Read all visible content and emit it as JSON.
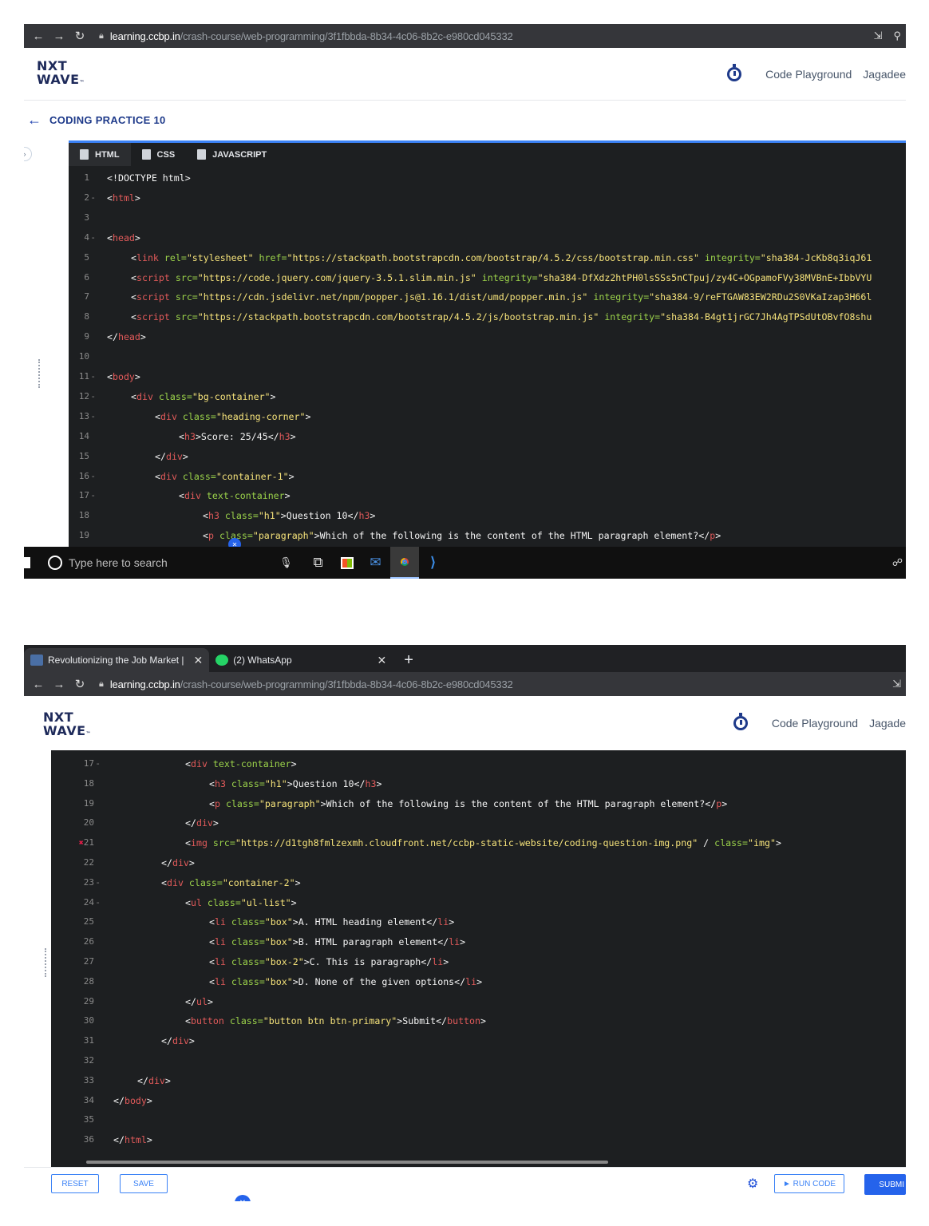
{
  "browser": {
    "url_host": "learning.ccbp.in",
    "url_path": "/crash-course/web-programming/3f1fbbda-8b34-4c06-8b2c-e980cd045332",
    "tabs": [
      {
        "title": "Revolutionizing the Job Market |",
        "favicon_color": "#4a6fa5"
      },
      {
        "title": "(2) WhatsApp",
        "favicon_color": "#25d366"
      }
    ],
    "new_tab": "+"
  },
  "header": {
    "logo_line1": "NXT",
    "logo_line2": "WAVE",
    "logo_tm": "™",
    "code_playground": "Code Playground",
    "user_truncated_1": "Jagadee",
    "user_truncated_2": "Jagade"
  },
  "practice": {
    "title": "CODING PRACTICE 10"
  },
  "editor_tabs": [
    {
      "label": "HTML"
    },
    {
      "label": "CSS"
    },
    {
      "label": "JAVASCRIPT"
    }
  ],
  "taskbar": {
    "search_placeholder": "Type here to search"
  },
  "footer": {
    "reset": "RESET",
    "save": "SAVE",
    "run_code": "► RUN CODE",
    "submit": "SUBMI"
  },
  "code_top": [
    {
      "n": "1",
      "fold": false,
      "indent": 0,
      "parts": [
        [
          "tx",
          "<!DOCTYPE html>"
        ]
      ]
    },
    {
      "n": "2",
      "fold": true,
      "indent": 0,
      "parts": [
        [
          "tx",
          "<"
        ],
        [
          "tg",
          "html"
        ],
        [
          "tx",
          ">"
        ]
      ]
    },
    {
      "n": "3",
      "fold": false,
      "indent": 0,
      "parts": []
    },
    {
      "n": "4",
      "fold": true,
      "indent": 0,
      "parts": [
        [
          "tx",
          "<"
        ],
        [
          "tg",
          "head"
        ],
        [
          "tx",
          ">"
        ]
      ]
    },
    {
      "n": "5",
      "fold": false,
      "indent": 1,
      "parts": [
        [
          "tx",
          "<"
        ],
        [
          "tg",
          "link"
        ],
        [
          "at",
          " rel="
        ],
        [
          "st",
          "\"stylesheet\""
        ],
        [
          "at",
          " href="
        ],
        [
          "st",
          "\"https://stackpath.bootstrapcdn.com/bootstrap/4.5.2/css/bootstrap.min.css\""
        ],
        [
          "at",
          " integrity="
        ],
        [
          "st",
          "\"sha384-JcKb8q3iqJ61"
        ]
      ]
    },
    {
      "n": "6",
      "fold": false,
      "indent": 1,
      "parts": [
        [
          "tx",
          "<"
        ],
        [
          "tg",
          "script"
        ],
        [
          "at",
          " src="
        ],
        [
          "st",
          "\"https://code.jquery.com/jquery-3.5.1.slim.min.js\""
        ],
        [
          "at",
          " integrity="
        ],
        [
          "st",
          "\"sha384-DfXdz2htPH0lsSSs5nCTpuj/zy4C+OGpamoFVy38MVBnE+IbbVYU"
        ]
      ]
    },
    {
      "n": "7",
      "fold": false,
      "indent": 1,
      "parts": [
        [
          "tx",
          "<"
        ],
        [
          "tg",
          "script"
        ],
        [
          "at",
          " src="
        ],
        [
          "st",
          "\"https://cdn.jsdelivr.net/npm/popper.js@1.16.1/dist/umd/popper.min.js\""
        ],
        [
          "at",
          " integrity="
        ],
        [
          "st",
          "\"sha384-9/reFTGAW83EW2RDu2S0VKaIzap3H66l"
        ]
      ]
    },
    {
      "n": "8",
      "fold": false,
      "indent": 1,
      "parts": [
        [
          "tx",
          "<"
        ],
        [
          "tg",
          "script"
        ],
        [
          "at",
          " src="
        ],
        [
          "st",
          "\"https://stackpath.bootstrapcdn.com/bootstrap/4.5.2/js/bootstrap.min.js\""
        ],
        [
          "at",
          " integrity="
        ],
        [
          "st",
          "\"sha384-B4gt1jrGC7Jh4AgTPSdUtOBvfO8shu"
        ]
      ]
    },
    {
      "n": "9",
      "fold": false,
      "indent": 0,
      "parts": [
        [
          "tx",
          "</"
        ],
        [
          "tg",
          "head"
        ],
        [
          "tx",
          ">"
        ]
      ]
    },
    {
      "n": "10",
      "fold": false,
      "indent": 0,
      "parts": []
    },
    {
      "n": "11",
      "fold": true,
      "indent": 0,
      "parts": [
        [
          "tx",
          "<"
        ],
        [
          "tg",
          "body"
        ],
        [
          "tx",
          ">"
        ]
      ]
    },
    {
      "n": "12",
      "fold": true,
      "indent": 1,
      "parts": [
        [
          "tx",
          "<"
        ],
        [
          "tg",
          "div"
        ],
        [
          "at",
          " class="
        ],
        [
          "st",
          "\"bg-container\""
        ],
        [
          "tx",
          ">"
        ]
      ]
    },
    {
      "n": "13",
      "fold": true,
      "indent": 2,
      "parts": [
        [
          "tx",
          "<"
        ],
        [
          "tg",
          "div"
        ],
        [
          "at",
          " class="
        ],
        [
          "st",
          "\"heading-corner\""
        ],
        [
          "tx",
          ">"
        ]
      ]
    },
    {
      "n": "14",
      "fold": false,
      "indent": 3,
      "parts": [
        [
          "tx",
          "<"
        ],
        [
          "tg",
          "h3"
        ],
        [
          "tx",
          ">Score: 25/45</"
        ],
        [
          "tg",
          "h3"
        ],
        [
          "tx",
          ">"
        ]
      ]
    },
    {
      "n": "15",
      "fold": false,
      "indent": 2,
      "parts": [
        [
          "tx",
          "</"
        ],
        [
          "tg",
          "div"
        ],
        [
          "tx",
          ">"
        ]
      ]
    },
    {
      "n": "16",
      "fold": true,
      "indent": 2,
      "parts": [
        [
          "tx",
          "<"
        ],
        [
          "tg",
          "div"
        ],
        [
          "at",
          " class="
        ],
        [
          "st",
          "\"container-1\""
        ],
        [
          "tx",
          ">"
        ]
      ]
    },
    {
      "n": "17",
      "fold": true,
      "indent": 3,
      "parts": [
        [
          "tx",
          "<"
        ],
        [
          "tg",
          "div"
        ],
        [
          "at",
          " text-container"
        ],
        [
          "tx",
          ">"
        ]
      ]
    },
    {
      "n": "18",
      "fold": false,
      "indent": 4,
      "parts": [
        [
          "tx",
          "<"
        ],
        [
          "tg",
          "h3"
        ],
        [
          "at",
          " class="
        ],
        [
          "st",
          "\"h1\""
        ],
        [
          "tx",
          ">Question 10</"
        ],
        [
          "tg",
          "h3"
        ],
        [
          "tx",
          ">"
        ]
      ]
    },
    {
      "n": "19",
      "fold": false,
      "indent": 4,
      "parts": [
        [
          "tx",
          "<"
        ],
        [
          "tg",
          "p"
        ],
        [
          "at",
          " class="
        ],
        [
          "st",
          "\"paragraph\""
        ],
        [
          "tx",
          ">Which of the following is the content of the HTML paragraph element?</"
        ],
        [
          "tg",
          "p"
        ],
        [
          "tx",
          ">"
        ]
      ]
    }
  ],
  "code_bottom": [
    {
      "n": "17",
      "fold": true,
      "indent": 3,
      "parts": [
        [
          "tx",
          "<"
        ],
        [
          "tg",
          "div"
        ],
        [
          "at",
          " text-container"
        ],
        [
          "tx",
          ">"
        ]
      ]
    },
    {
      "n": "18",
      "fold": false,
      "indent": 4,
      "parts": [
        [
          "tx",
          "<"
        ],
        [
          "tg",
          "h3"
        ],
        [
          "at",
          " class="
        ],
        [
          "st",
          "\"h1\""
        ],
        [
          "tx",
          ">Question 10</"
        ],
        [
          "tg",
          "h3"
        ],
        [
          "tx",
          ">"
        ]
      ]
    },
    {
      "n": "19",
      "fold": false,
      "indent": 4,
      "parts": [
        [
          "tx",
          "<"
        ],
        [
          "tg",
          "p"
        ],
        [
          "at",
          " class="
        ],
        [
          "st",
          "\"paragraph\""
        ],
        [
          "tx",
          ">Which of the following is the content of the HTML paragraph element?</"
        ],
        [
          "tg",
          "p"
        ],
        [
          "tx",
          ">"
        ]
      ]
    },
    {
      "n": "20",
      "fold": false,
      "indent": 3,
      "parts": [
        [
          "tx",
          "</"
        ],
        [
          "tg",
          "div"
        ],
        [
          "tx",
          ">"
        ]
      ]
    },
    {
      "n": "21",
      "fold": false,
      "indent": 3,
      "error": true,
      "parts": [
        [
          "tx",
          "<"
        ],
        [
          "tg",
          "img"
        ],
        [
          "at",
          " src="
        ],
        [
          "st",
          "\"https://d1tgh8fmlzexmh.cloudfront.net/ccbp-static-website/coding-question-img.png\""
        ],
        [
          "tx",
          " / "
        ],
        [
          "at",
          "class="
        ],
        [
          "st",
          "\"img\""
        ],
        [
          "tx",
          ">"
        ]
      ]
    },
    {
      "n": "22",
      "fold": false,
      "indent": 2,
      "parts": [
        [
          "tx",
          "</"
        ],
        [
          "tg",
          "div"
        ],
        [
          "tx",
          ">"
        ]
      ]
    },
    {
      "n": "23",
      "fold": true,
      "indent": 2,
      "parts": [
        [
          "tx",
          "<"
        ],
        [
          "tg",
          "div"
        ],
        [
          "at",
          " class="
        ],
        [
          "st",
          "\"container-2\""
        ],
        [
          "tx",
          ">"
        ]
      ]
    },
    {
      "n": "24",
      "fold": true,
      "indent": 3,
      "parts": [
        [
          "tx",
          "<"
        ],
        [
          "tg",
          "ul"
        ],
        [
          "at",
          " class="
        ],
        [
          "st",
          "\"ul-list\""
        ],
        [
          "tx",
          ">"
        ]
      ]
    },
    {
      "n": "25",
      "fold": false,
      "indent": 4,
      "parts": [
        [
          "tx",
          "<"
        ],
        [
          "tg",
          "li"
        ],
        [
          "at",
          " class="
        ],
        [
          "st",
          "\"box\""
        ],
        [
          "tx",
          ">A. HTML heading element</"
        ],
        [
          "tg",
          "li"
        ],
        [
          "tx",
          ">"
        ]
      ]
    },
    {
      "n": "26",
      "fold": false,
      "indent": 4,
      "parts": [
        [
          "tx",
          "<"
        ],
        [
          "tg",
          "li"
        ],
        [
          "at",
          " class="
        ],
        [
          "st",
          "\"box\""
        ],
        [
          "tx",
          ">B. HTML paragraph element</"
        ],
        [
          "tg",
          "li"
        ],
        [
          "tx",
          ">"
        ]
      ]
    },
    {
      "n": "27",
      "fold": false,
      "indent": 4,
      "parts": [
        [
          "tx",
          "<"
        ],
        [
          "tg",
          "li"
        ],
        [
          "at",
          " class="
        ],
        [
          "st",
          "\"box-2\""
        ],
        [
          "tx",
          ">C. This is paragraph</"
        ],
        [
          "tg",
          "li"
        ],
        [
          "tx",
          ">"
        ]
      ]
    },
    {
      "n": "28",
      "fold": false,
      "indent": 4,
      "parts": [
        [
          "tx",
          "<"
        ],
        [
          "tg",
          "li"
        ],
        [
          "at",
          " class="
        ],
        [
          "st",
          "\"box\""
        ],
        [
          "tx",
          ">D. None of the given options</"
        ],
        [
          "tg",
          "li"
        ],
        [
          "tx",
          ">"
        ]
      ]
    },
    {
      "n": "29",
      "fold": false,
      "indent": 3,
      "parts": [
        [
          "tx",
          "</"
        ],
        [
          "tg",
          "ul"
        ],
        [
          "tx",
          ">"
        ]
      ]
    },
    {
      "n": "30",
      "fold": false,
      "indent": 3,
      "parts": [
        [
          "tx",
          "<"
        ],
        [
          "tg",
          "button"
        ],
        [
          "at",
          " class="
        ],
        [
          "st",
          "\"button btn btn-primary\""
        ],
        [
          "tx",
          ">Submit</"
        ],
        [
          "tg",
          "button"
        ],
        [
          "tx",
          ">"
        ]
      ]
    },
    {
      "n": "31",
      "fold": false,
      "indent": 2,
      "parts": [
        [
          "tx",
          "</"
        ],
        [
          "tg",
          "div"
        ],
        [
          "tx",
          ">"
        ]
      ]
    },
    {
      "n": "32",
      "fold": false,
      "indent": 0,
      "parts": []
    },
    {
      "n": "33",
      "fold": false,
      "indent": 1,
      "parts": [
        [
          "tx",
          "</"
        ],
        [
          "tg",
          "div"
        ],
        [
          "tx",
          ">"
        ]
      ]
    },
    {
      "n": "34",
      "fold": false,
      "indent": 0,
      "parts": [
        [
          "tx",
          "</"
        ],
        [
          "tg",
          "body"
        ],
        [
          "tx",
          ">"
        ]
      ]
    },
    {
      "n": "35",
      "fold": false,
      "indent": 0,
      "parts": []
    },
    {
      "n": "36",
      "fold": false,
      "indent": 0,
      "parts": [
        [
          "tx",
          "</"
        ],
        [
          "tg",
          "html"
        ],
        [
          "tx",
          ">"
        ]
      ]
    }
  ]
}
